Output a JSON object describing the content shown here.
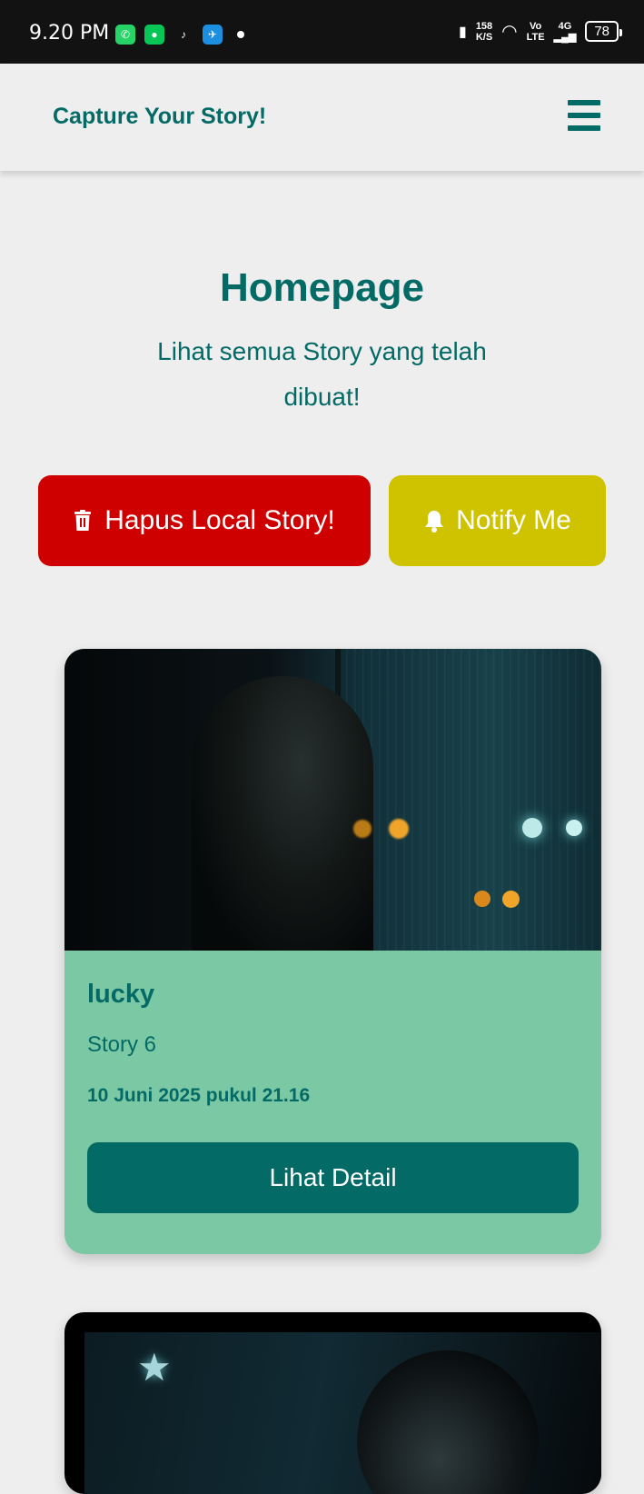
{
  "status_bar": {
    "time": "9.20 PM",
    "app_icons": [
      "whatsapp-icon",
      "line-icon",
      "tiktok-icon",
      "bird-app-icon"
    ],
    "net_speed_value": "158",
    "net_speed_unit": "K/S",
    "volte_top": "Vo",
    "volte_bottom": "LTE",
    "network": "4G",
    "battery": "78"
  },
  "header": {
    "brand": "Capture Your Story!",
    "menu_icon": "hamburger-menu-icon"
  },
  "hero": {
    "title": "Homepage",
    "subtitle": "Lihat semua Story yang telah dibuat!"
  },
  "actions": {
    "delete_label": "Hapus Local Story!",
    "delete_icon": "trash-icon",
    "delete_color": "#cf0000",
    "notify_label": "Notify Me",
    "notify_icon": "bell-icon",
    "notify_color": "#cfc300"
  },
  "stories": [
    {
      "name": "lucky",
      "description": "Story 6",
      "date": "10 Juni 2025 pukul 21.16",
      "button_label": "Lihat Detail"
    }
  ],
  "colors": {
    "primary": "#046a66",
    "card_bg": "#7bc8a4",
    "page_bg": "#eeeeee"
  }
}
